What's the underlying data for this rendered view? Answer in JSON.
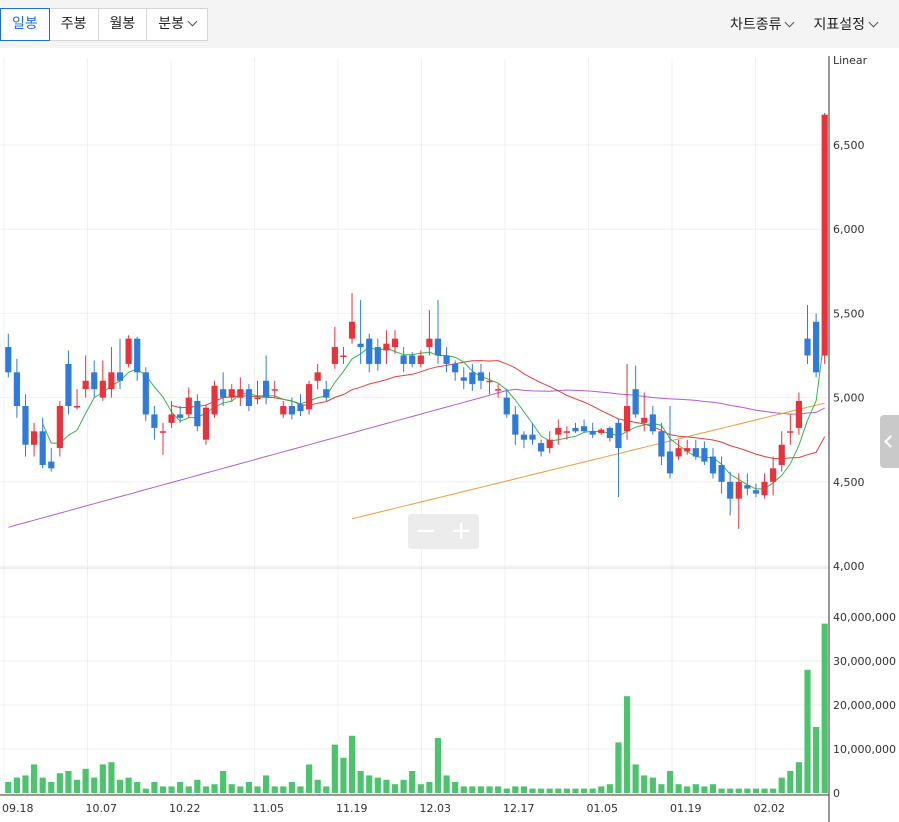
{
  "period_tabs": [
    {
      "label": "일봉",
      "active": true,
      "dropdown": false
    },
    {
      "label": "주봉",
      "active": false,
      "dropdown": false
    },
    {
      "label": "월봉",
      "active": false,
      "dropdown": false
    },
    {
      "label": "분봉",
      "active": false,
      "dropdown": true
    }
  ],
  "menu": {
    "chart_type": "차트종류",
    "indicator_settings": "지표설정"
  },
  "zoom": {
    "minus": "−",
    "plus": "+"
  },
  "icons": {
    "side_handle": "chevron-left-icon",
    "dropdown": "chevron-down-icon"
  },
  "colors": {
    "up": "#e8323c",
    "down": "#2f7bd9",
    "volume": "#4cc46e",
    "ma5": "#3cb44b",
    "ma20": "#e0403a",
    "ma60": "#b45bd6",
    "ma120": "#ee9a3a"
  },
  "chart_data": {
    "type": "candlestick",
    "scale_label": "Linear",
    "ylim": [
      4000,
      6800
    ],
    "y_ticks": [
      "4,000",
      "4,500",
      "5,000",
      "5,500",
      "6,000",
      "6,500"
    ],
    "volume_ticks": [
      "0",
      "10,000,000",
      "20,000,000",
      "30,000,000",
      "40,000,000"
    ],
    "x_ticks": [
      "09.18",
      "10.07",
      "10.22",
      "11.05",
      "11.19",
      "12.03",
      "12.17",
      "01.05",
      "01.19",
      "02.02"
    ],
    "candles": [
      [
        5300,
        5150,
        5380,
        5120
      ],
      [
        5150,
        4950,
        5230,
        4880
      ],
      [
        4950,
        4720,
        5020,
        4650
      ],
      [
        4720,
        4800,
        4850,
        4650
      ],
      [
        4800,
        4600,
        4880,
        4580
      ],
      [
        4620,
        4580,
        4700,
        4560
      ],
      [
        4700,
        4950,
        4980,
        4650
      ],
      [
        5200,
        4950,
        5280,
        4900
      ],
      [
        4950,
        4950,
        5050,
        4930
      ],
      [
        5050,
        5100,
        5250,
        5000
      ],
      [
        5150,
        5050,
        5220,
        5000
      ],
      [
        5000,
        5100,
        5220,
        4980
      ],
      [
        5050,
        5150,
        5300,
        5000
      ],
      [
        5150,
        5100,
        5350,
        5050
      ],
      [
        5200,
        5350,
        5370,
        5180
      ],
      [
        5350,
        5150,
        5360,
        5100
      ],
      [
        5150,
        4900,
        5180,
        4860
      ],
      [
        4900,
        4820,
        4950,
        4750
      ],
      [
        4800,
        4800,
        4850,
        4660
      ],
      [
        4850,
        4900,
        4980,
        4820
      ],
      [
        4900,
        4880,
        4950,
        4850
      ],
      [
        4900,
        5000,
        5060,
        4880
      ],
      [
        4980,
        4830,
        5020,
        4800
      ],
      [
        4750,
        4940,
        4960,
        4720
      ],
      [
        4900,
        5070,
        5100,
        4880
      ],
      [
        5050,
        5000,
        5150,
        4950
      ],
      [
        5000,
        5050,
        5080,
        4980
      ],
      [
        5000,
        5050,
        5120,
        4950
      ],
      [
        5050,
        4950,
        5080,
        4920
      ],
      [
        5000,
        5000,
        5100,
        4960
      ],
      [
        5100,
        5000,
        5250,
        4960
      ],
      [
        5050,
        5050,
        5100,
        5000
      ],
      [
        4900,
        4950,
        4980,
        4880
      ],
      [
        4950,
        4900,
        5000,
        4870
      ],
      [
        4960,
        4920,
        5020,
        4890
      ],
      [
        4930,
        5080,
        5100,
        4900
      ],
      [
        5100,
        5150,
        5200,
        5050
      ],
      [
        5050,
        5000,
        5100,
        4980
      ],
      [
        5200,
        5300,
        5420,
        5170
      ],
      [
        5250,
        5250,
        5300,
        5200
      ],
      [
        5350,
        5450,
        5620,
        5320
      ],
      [
        5320,
        5300,
        5580,
        5200
      ],
      [
        5350,
        5200,
        5380,
        5150
      ],
      [
        5300,
        5200,
        5350,
        5160
      ],
      [
        5280,
        5320,
        5400,
        5200
      ],
      [
        5300,
        5350,
        5400,
        5260
      ],
      [
        5250,
        5200,
        5300,
        5150
      ],
      [
        5250,
        5200,
        5270,
        5180
      ],
      [
        5200,
        5250,
        5280,
        5180
      ],
      [
        5300,
        5350,
        5520,
        5250
      ],
      [
        5350,
        5250,
        5580,
        5200
      ],
      [
        5250,
        5200,
        5300,
        5150
      ],
      [
        5200,
        5150,
        5220,
        5100
      ],
      [
        5120,
        5100,
        5180,
        5050
      ],
      [
        5150,
        5080,
        5200,
        5040
      ],
      [
        5150,
        5100,
        5200,
        5050
      ],
      [
        5100,
        5100,
        5150,
        5020
      ],
      [
        5050,
        5050,
        5080,
        5000
      ],
      [
        5000,
        4900,
        5050,
        4880
      ],
      [
        4900,
        4780,
        4950,
        4720
      ],
      [
        4780,
        4750,
        4800,
        4700
      ],
      [
        4780,
        4750,
        4850,
        4720
      ],
      [
        4730,
        4680,
        4750,
        4650
      ],
      [
        4700,
        4750,
        4800,
        4670
      ],
      [
        4780,
        4820,
        4870,
        4720
      ],
      [
        4800,
        4800,
        4830,
        4750
      ],
      [
        4820,
        4800,
        4850,
        4790
      ],
      [
        4830,
        4800,
        4870,
        4790
      ],
      [
        4800,
        4780,
        4850,
        4760
      ],
      [
        4790,
        4810,
        4820,
        4780
      ],
      [
        4820,
        4760,
        4830,
        4740
      ],
      [
        4850,
        4700,
        4870,
        4410
      ],
      [
        4800,
        4950,
        5200,
        4750
      ],
      [
        5050,
        4900,
        5190,
        4880
      ],
      [
        4850,
        4880,
        5030,
        4800
      ],
      [
        4900,
        4800,
        4950,
        4780
      ],
      [
        4800,
        4650,
        4850,
        4600
      ],
      [
        4680,
        4550,
        4950,
        4520
      ],
      [
        4650,
        4700,
        4750,
        4630
      ],
      [
        4680,
        4700,
        4750,
        4660
      ],
      [
        4700,
        4650,
        4750,
        4630
      ],
      [
        4700,
        4620,
        4740,
        4600
      ],
      [
        4650,
        4550,
        4700,
        4520
      ],
      [
        4600,
        4500,
        4650,
        4430
      ],
      [
        4500,
        4400,
        4560,
        4300
      ],
      [
        4400,
        4500,
        4550,
        4220
      ],
      [
        4480,
        4460,
        4550,
        4420
      ],
      [
        4450,
        4430,
        4490,
        4410
      ],
      [
        4420,
        4500,
        4550,
        4400
      ],
      [
        4500,
        4580,
        4650,
        4420
      ],
      [
        4600,
        4720,
        4800,
        4560
      ],
      [
        4800,
        4800,
        4900,
        4720
      ],
      [
        4820,
        4980,
        5030,
        4780
      ],
      [
        5350,
        5250,
        5550,
        5200
      ],
      [
        5450,
        5150,
        5500,
        5120
      ],
      [
        5250,
        6680,
        6690,
        5200
      ]
    ],
    "volume": [
      2.5,
      3.5,
      4,
      6.5,
      3.5,
      2.5,
      4.5,
      5,
      3,
      5.5,
      3.5,
      6.5,
      7,
      3,
      3.5,
      2.5,
      1,
      2.5,
      1.5,
      1.5,
      2.5,
      1.5,
      3,
      1.5,
      2,
      5,
      2,
      1.5,
      2.5,
      1.5,
      4,
      1.5,
      1.5,
      2.5,
      1.5,
      6.5,
      3,
      1.5,
      11,
      8,
      13,
      5,
      4,
      3.5,
      3,
      2,
      3,
      5,
      2,
      2.5,
      12.5,
      4,
      2.5,
      1.5,
      1.5,
      1.5,
      1.5,
      1.5,
      1,
      1.5,
      1.5,
      1,
      1,
      1,
      1,
      1,
      1,
      1,
      1,
      1.5,
      2,
      11.5,
      22,
      6.5,
      4,
      3.5,
      2,
      5,
      2,
      1.5,
      2,
      1.5,
      2,
      1,
      1,
      1,
      1,
      1,
      1,
      1,
      3.5,
      5,
      7,
      28,
      15,
      38.5
    ]
  }
}
